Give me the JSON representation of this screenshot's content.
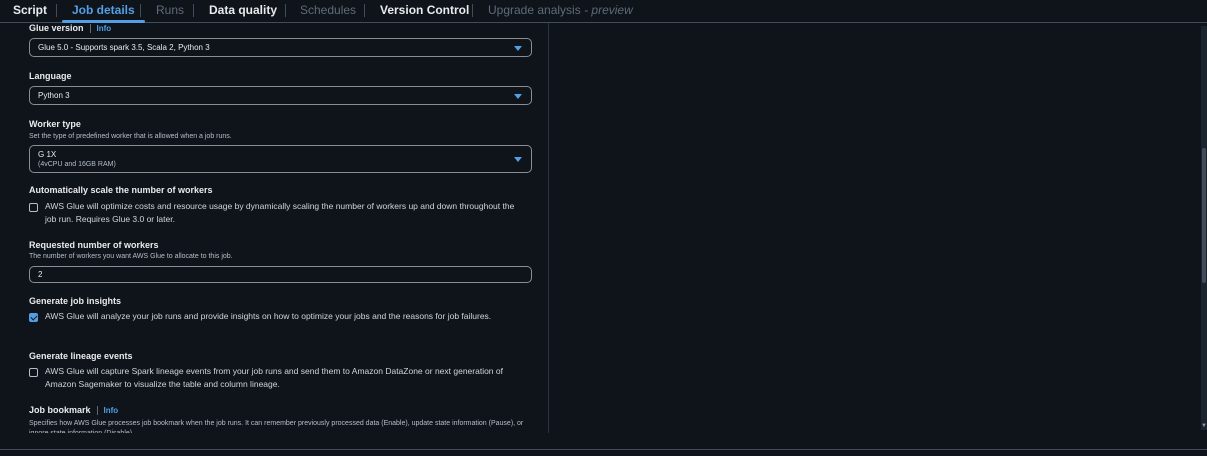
{
  "tabs": [
    {
      "label": "Script",
      "state": "normal"
    },
    {
      "label": "Job details",
      "state": "active"
    },
    {
      "label": "Runs",
      "state": "disabled"
    },
    {
      "label": "Data quality",
      "state": "normal"
    },
    {
      "label": "Schedules",
      "state": "disabled"
    },
    {
      "label": "Version Control",
      "state": "normal"
    },
    {
      "label": "Upgrade analysis",
      "suffix": "- preview",
      "state": "disabled"
    }
  ],
  "form": {
    "glue_version": {
      "label": "Glue version",
      "info": "Info",
      "value": "Glue 5.0 - Supports spark 3.5, Scala 2, Python 3"
    },
    "language": {
      "label": "Language",
      "value": "Python 3"
    },
    "worker_type": {
      "label": "Worker type",
      "description": "Set the type of predefined worker that is allowed when a job runs.",
      "value": "G 1X",
      "sub": "(4vCPU and 16GB RAM)"
    },
    "autoscale": {
      "label": "Automatically scale the number of workers",
      "checked": false,
      "text": "AWS Glue will optimize costs and resource usage by dynamically scaling the number of workers up and down throughout the job run. Requires Glue 3.0 or later."
    },
    "workers": {
      "label": "Requested number of workers",
      "description": "The number of workers you want AWS Glue to allocate to this job.",
      "value": "2"
    },
    "insights": {
      "label": "Generate job insights",
      "checked": true,
      "text": "AWS Glue will analyze your job runs and provide insights on how to optimize your jobs and the reasons for job failures."
    },
    "lineage": {
      "label": "Generate lineage events",
      "checked": false,
      "text": "AWS Glue will capture Spark lineage events from your job runs and send them to Amazon DataZone or next generation of Amazon Sagemaker to visualize the table and column lineage."
    },
    "bookmark": {
      "label": "Job bookmark",
      "info": "Info",
      "description": "Specifies how AWS Glue processes job bookmark when the job runs. It can remember previously processed data (Enable), update state information (Pause), or ignore state information (Disable)."
    }
  },
  "colors": {
    "accent": "#539fe5",
    "background": "#0f141a",
    "border": "#414d5c"
  }
}
